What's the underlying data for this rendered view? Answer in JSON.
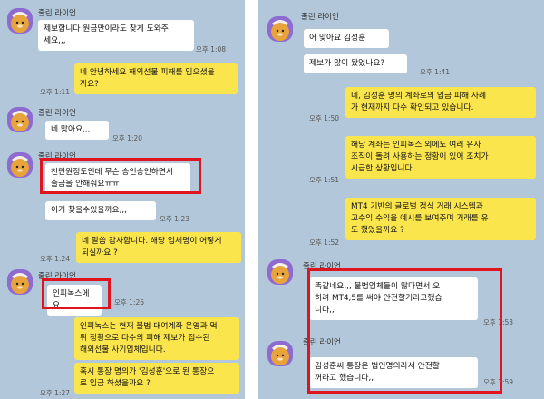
{
  "contact_name": "줄린 라이언",
  "colors": {
    "background": "#b2c7d9",
    "incoming_bubble": "#ffffff",
    "outgoing_bubble": "#fbe54d",
    "highlight": "#e0141e"
  },
  "left_panel": {
    "messages": [
      {
        "from": "contact",
        "text": "제보합니다 원금만이라도 찾게 도와주\n세요,,,",
        "time": "오후 1:08"
      },
      {
        "from": "me",
        "text": "네 안녕하세요 해외선물 피해를 입으셨을\n까요?",
        "time": "오후 1:11"
      },
      {
        "from": "contact",
        "text": "네 맞아요,,,",
        "time": "오후 1:20"
      },
      {
        "from": "contact",
        "text": "천만원정도인데 무슨 승인승인하면서\n출금을 안해줘요ㅠㅠ",
        "time": ""
      },
      {
        "from": "contact",
        "text": "이거 찾을수있을까요,,,",
        "time": "오후 1:23"
      },
      {
        "from": "me",
        "text": "네 말씀 감사합니다. 해당 업체명이 어떻게\n되실까요 ?",
        "time": "오후 1:24"
      },
      {
        "from": "contact",
        "text": "인피녹스에요",
        "time": "오후 1:26"
      },
      {
        "from": "me",
        "text": "인피녹스는 현재 불법 대여계좌 운영과 먹\n튀 정황으로 다수의 피해 제보가 접수된\n해외선물 사기업체입니다.",
        "time": ""
      },
      {
        "from": "me",
        "text": "혹시 통장 명의가 '김성훈'으로 된 통장으\n로 입금 하셨을까요 ?",
        "time": "오후 1:27"
      }
    ]
  },
  "right_panel": {
    "messages": [
      {
        "from": "contact",
        "text": "어 맞아요 김성훈",
        "time": ""
      },
      {
        "from": "contact",
        "text": "제보가 많이 왔었나요?",
        "time": "오후 1:41"
      },
      {
        "from": "me",
        "text": "네, 김성훈 명의 계좌로의 입금 피해 사례\n가 현재까지 다수 확인되고 있습니다.",
        "time": "오후 1:50"
      },
      {
        "from": "me",
        "text": "해당 계좌는 인피녹스 외에도 여러 유사\n조직이 돌려 사용하는 정황이 있어 조치가\n시급한 상황입니다.",
        "time": "오후 1:51"
      },
      {
        "from": "me",
        "text": "MT4 기반의 글로벌 정식 거래 시스템과\n고수익 수익을 예시를 보여주며 거래를 유\n도 했었을까요 ?",
        "time": "오후 1:52"
      },
      {
        "from": "contact",
        "text": "똑같네요,,, 불법업체들이 많다면서 오\n히려 MT4,5를 써야 안전할거라고했습\n니다,,",
        "time": "오후 1:53"
      },
      {
        "from": "contact",
        "text": "김성훈씨 통장은 법인명의라서 안전할\n꺼라고 했습니다,,",
        "time": "오후 1:59"
      }
    ]
  }
}
